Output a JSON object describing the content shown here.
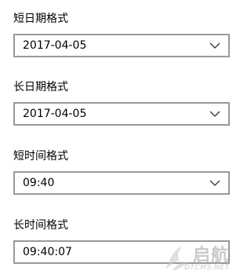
{
  "short_date": {
    "label": "短日期格式",
    "value": "2017-04-05",
    "icon": "chevron-down-icon"
  },
  "long_date": {
    "label": "长日期格式",
    "value": "2017-04-05",
    "icon": "chevron-down-icon"
  },
  "short_time": {
    "label": "短时间格式",
    "value": "09:40",
    "icon": "chevron-down-icon"
  },
  "long_time": {
    "label": "长时间格式",
    "value": "09:40:07"
  },
  "watermark": {
    "title": "启航",
    "subtitle": "DTCMS.NET"
  },
  "colors": {
    "field_border": "#999999",
    "text": "#000000",
    "watermark": "#9aa0a8"
  }
}
